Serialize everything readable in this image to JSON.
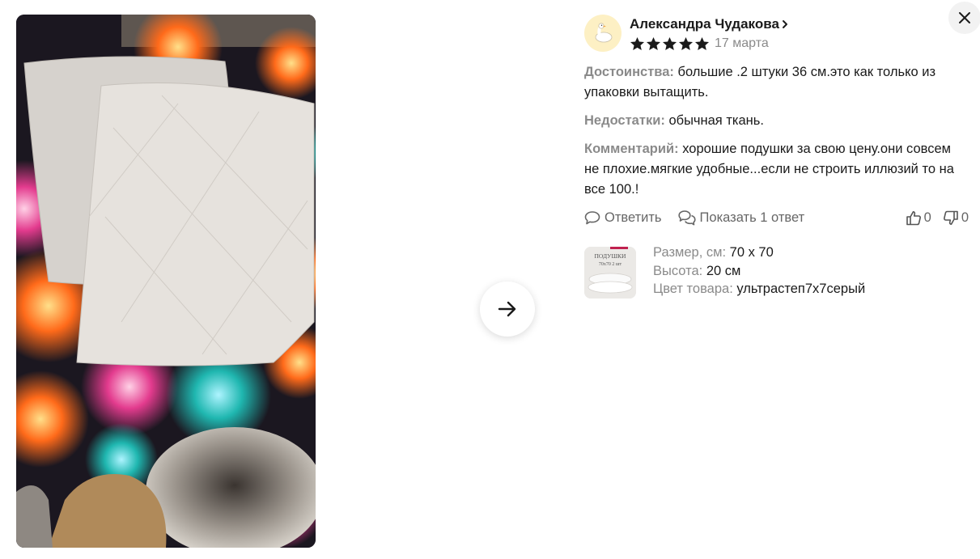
{
  "review": {
    "author": "Александра Чудакова",
    "rating": 5,
    "date": "17 марта",
    "pros_label": "Достоинства:",
    "pros_text": "большие .2 штуки 36 см.это как только из упаковки вытащить.",
    "cons_label": "Недостатки:",
    "cons_text": "обычная ткань.",
    "comment_label": "Комментарий:",
    "comment_text": "хорошие подушки за свою цену.они совсем не плохие.мягкие удобные...если не строить иллюзий то на все 100.!",
    "reply_label": "Ответить",
    "show_replies_label": "Показать 1 ответ",
    "likes": "0",
    "dislikes": "0"
  },
  "product": {
    "size_label": "Размер, см:",
    "size_value": "70 х 70",
    "height_label": "Высота:",
    "height_value": "20 см",
    "color_label": "Цвет товара:",
    "color_value": "ультрастеп7х7серый",
    "thumb_title": "ПОДУШКИ",
    "thumb_sub": "70х70  2 шт"
  },
  "icons": {
    "avatar": "goose-avatar-icon",
    "author_link": "chevron-right-icon",
    "star": "star-icon",
    "reply": "comment-icon",
    "replies": "comments-icon",
    "like": "thumb-up-icon",
    "dislike": "thumb-down-icon",
    "next": "arrow-right-icon",
    "close": "close-icon"
  },
  "colors": {
    "label_gray": "#8a8a8a",
    "avatar_bg": "#fdf0c4",
    "star": "#1a1a1a"
  }
}
